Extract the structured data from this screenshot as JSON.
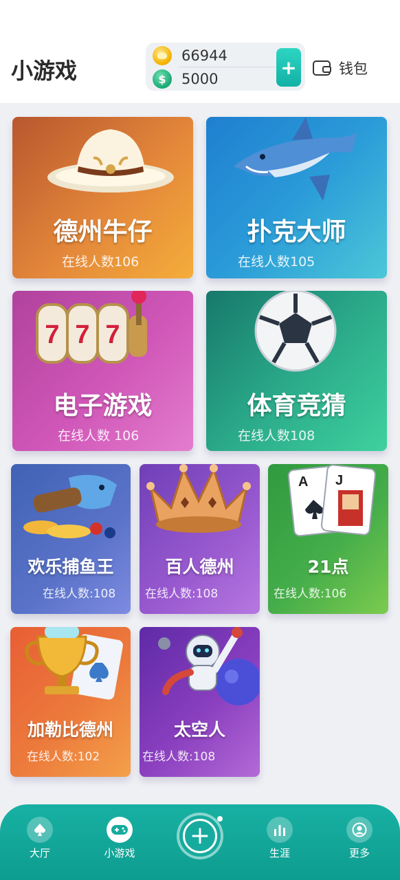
{
  "header": {
    "title": "小游戏",
    "gold_balance": "66944",
    "cash_balance": "5000",
    "add_label": "+",
    "wallet_label": "钱包"
  },
  "games": [
    {
      "title": "德州牛仔",
      "online": "在线人数106",
      "icon": "cowboy-hat-icon"
    },
    {
      "title": "扑克大师",
      "online": "在线人数105",
      "icon": "shark-icon"
    },
    {
      "title": "电子游戏",
      "online": "在线人数 106",
      "icon": "slot-machine-icon"
    },
    {
      "title": "体育竞猜",
      "online": "在线人数108",
      "icon": "soccer-ball-icon"
    },
    {
      "title": "欢乐捕鱼王",
      "online": "在线人数:108",
      "icon": "fishing-cannon-icon"
    },
    {
      "title": "百人德州",
      "online": "在线人数:108",
      "icon": "crown-icon"
    },
    {
      "title": "21点",
      "online": "在线人数:106",
      "icon": "playing-cards-icon"
    },
    {
      "title": "加勒比德州",
      "online": "在线人数:102",
      "icon": "trophy-icon"
    },
    {
      "title": "太空人",
      "online": "在线人数:108",
      "icon": "astronaut-icon"
    }
  ],
  "nav": [
    {
      "label": "大厅",
      "icon": "spade-icon"
    },
    {
      "label": "小游戏",
      "icon": "gamepad-icon"
    },
    {
      "label": "",
      "icon": "plus-circle-icon"
    },
    {
      "label": "生涯",
      "icon": "bar-chart-icon"
    },
    {
      "label": "更多",
      "icon": "user-icon"
    }
  ],
  "colors": {
    "accent": "#14a99c",
    "card_cowboy": "#e3873a",
    "card_poker": "#2a9bd8",
    "card_slots": "#c94fb0",
    "card_sports": "#2aa989",
    "card_fish": "#5a73c9",
    "card_crown": "#9a5ad0",
    "card_21": "#45ad4a",
    "card_caribbean": "#ec7a3c",
    "card_astronaut": "#8a3fbf"
  }
}
